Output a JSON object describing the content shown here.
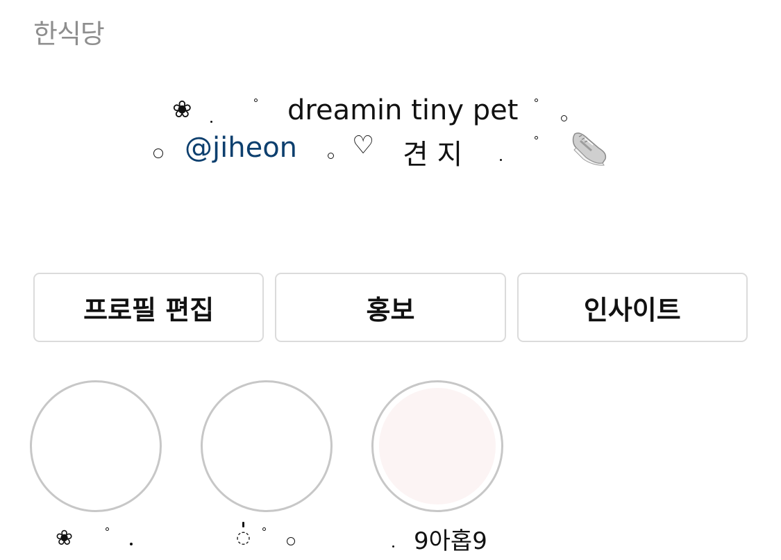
{
  "profile": {
    "category": "한식당",
    "bio": {
      "line1": {
        "flower": "❀",
        "text": "dreamin  tiny pet"
      },
      "line2": {
        "mention": "@jiheon",
        "heart": "♡",
        "text": "견 지"
      },
      "sneaker_icon": "sneaker-icon"
    }
  },
  "actions": {
    "edit_profile": "프로필 편집",
    "promote": "홍보",
    "insights": "인사이트"
  },
  "highlights": [
    {
      "label_prefix": "❀",
      "label": "",
      "fill": "#ffffff"
    },
    {
      "label_prefix": "◌",
      "label": "",
      "fill": "#ffffff"
    },
    {
      "label_prefix": "",
      "label": "9아홉9",
      "fill": "#fcf4f4"
    }
  ],
  "colors": {
    "mention": "#0d3f6e",
    "category": "#8e8e8e",
    "button_border": "#dbdbdb",
    "highlight_ring": "#c7c7c7"
  }
}
